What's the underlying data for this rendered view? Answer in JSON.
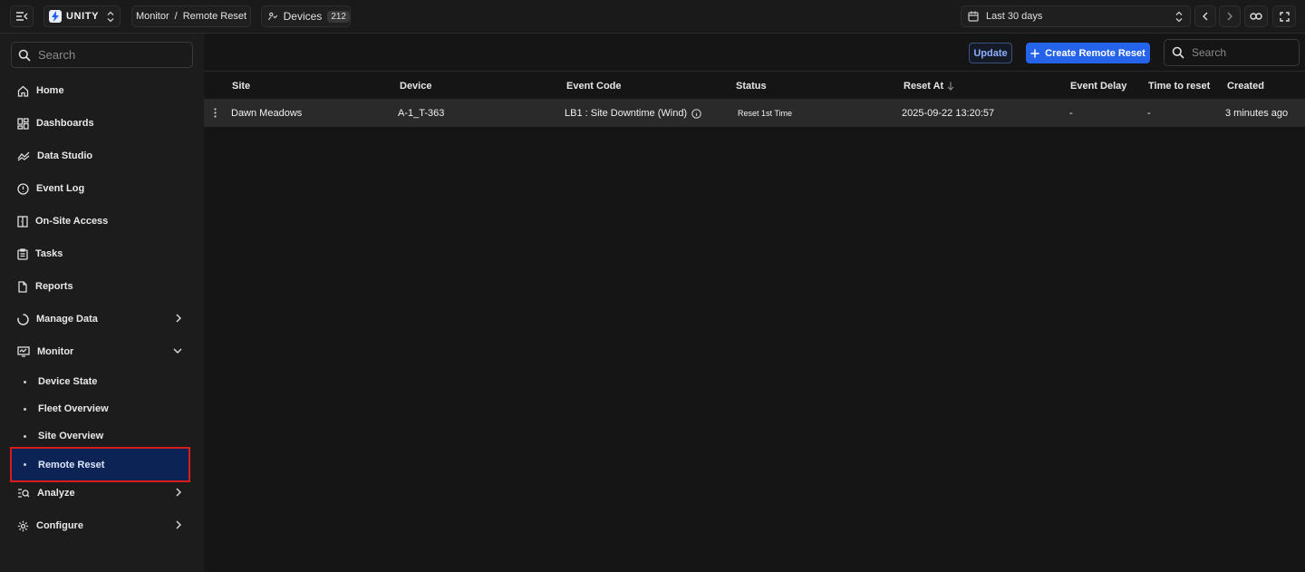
{
  "topbar": {
    "org_name": "UNITY",
    "breadcrumb": {
      "parent": "Monitor",
      "separator": "/",
      "current": "Remote Reset"
    },
    "devices": {
      "label": "Devices",
      "count": "212"
    },
    "date_range": "Last 30 days"
  },
  "sidebar": {
    "search_placeholder": "Search",
    "items": [
      {
        "label": "Home",
        "icon": "home-icon"
      },
      {
        "label": "Dashboards",
        "icon": "dashboard-icon"
      },
      {
        "label": "Data Studio",
        "icon": "chart-line-icon"
      },
      {
        "label": "Event Log",
        "icon": "alert-circle-icon"
      },
      {
        "label": "On-Site Access",
        "icon": "door-icon"
      },
      {
        "label": "Tasks",
        "icon": "clipboard-icon"
      },
      {
        "label": "Reports",
        "icon": "document-icon"
      },
      {
        "label": "Manage Data",
        "icon": "circle-loading-icon",
        "expandable": true
      },
      {
        "label": "Monitor",
        "icon": "monitor-icon",
        "expanded": true
      },
      {
        "label": "Analyze",
        "icon": "search-list-icon",
        "expandable": true
      },
      {
        "label": "Configure",
        "icon": "gear-icon",
        "expandable": true
      }
    ],
    "monitor_subitems": [
      "Device State",
      "Fleet Overview",
      "Site Overview",
      "Remote Reset"
    ],
    "active_subitem": "Remote Reset"
  },
  "toolbar": {
    "update_label": "Update",
    "create_label": "Create Remote Reset",
    "search_placeholder": "Search"
  },
  "table": {
    "columns": [
      "Site",
      "Device",
      "Event Code",
      "Status",
      "Reset At",
      "Event Delay",
      "Time to reset",
      "Created"
    ],
    "sorted_column": "Reset At",
    "sort_direction": "descending",
    "rows": [
      {
        "site": "Dawn Meadows",
        "device": "A-1_T-363",
        "event_code": "LB1 : Site Downtime (Wind)",
        "status": "Reset 1st Time",
        "reset_at": "2025-09-22 13:20:57",
        "event_delay": "-",
        "time_to_reset": "-",
        "created": "3 minutes ago"
      }
    ]
  },
  "colors": {
    "accent": "#2563eb",
    "active_nav_bg": "#0b2455",
    "highlight_border": "#d81b1b",
    "background": "#151515"
  }
}
